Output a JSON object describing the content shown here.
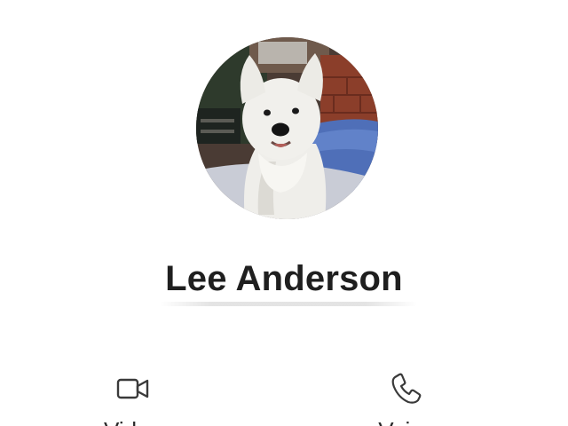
{
  "contact": {
    "name": "Lee Anderson"
  },
  "actions": [
    {
      "label": "Video",
      "icon": "video-camera-icon"
    },
    {
      "label": "Voice",
      "icon": "phone-icon"
    }
  ],
  "colors": {
    "text": "#1f1f1f",
    "icon": "#3a3a3a",
    "background": "#ffffff"
  }
}
